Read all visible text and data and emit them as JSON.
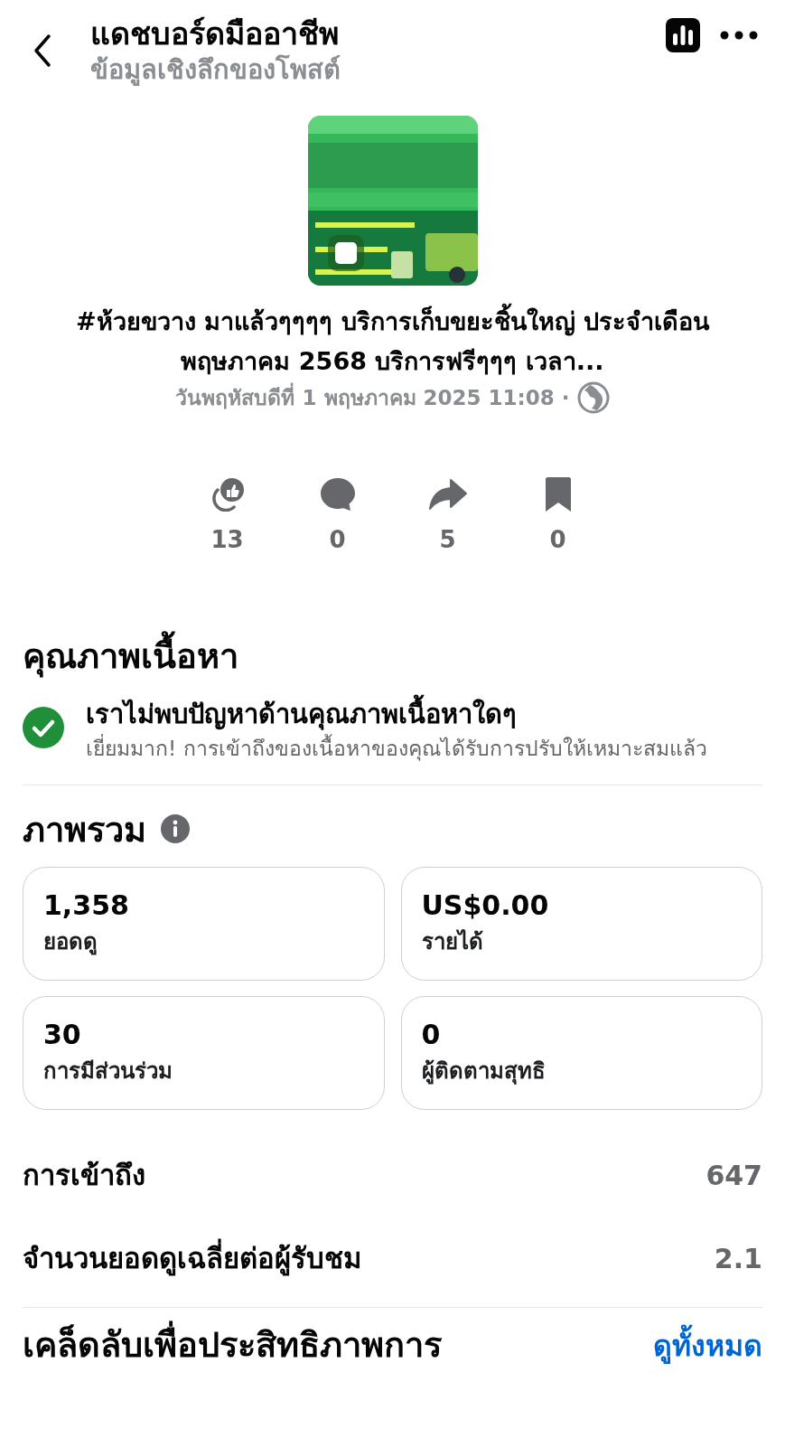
{
  "header": {
    "title": "แดชบอร์ดมืออาชีพ",
    "subtitle": "ข้อมูลเชิงลึกของโพสต์"
  },
  "post": {
    "text": "#ห้วยขวาง มาแล้วๆๆๆๆ บริการเก็บขยะชิ้นใหญ่ ประจำเดือน พฤษภาคม 2568 บริการฟรีๆๆๆ เวลา...",
    "date": "วันพฤหัสบดีที่ 1 พฤษภาคม  2025 11:08 ·"
  },
  "stats": [
    {
      "kind": "reactions",
      "count": "13"
    },
    {
      "kind": "comments",
      "count": "0"
    },
    {
      "kind": "shares",
      "count": "5"
    },
    {
      "kind": "saves",
      "count": "0"
    }
  ],
  "content_quality": {
    "heading": "คุณภาพเนื้อหา",
    "title": "เราไม่พบปัญหาด้านคุณภาพเนื้อหาใดๆ",
    "description": "เยี่ยมมาก! การเข้าถึงของเนื้อหาของคุณได้รับการปรับให้เหมาะสมแล้ว"
  },
  "overview": {
    "heading": "ภาพรวม",
    "cards": [
      {
        "value": "1,358",
        "label": "ยอดดู"
      },
      {
        "value": "US$0.00",
        "label": "รายได้"
      },
      {
        "value": "30",
        "label": "การมีส่วนร่วม"
      },
      {
        "value": "0",
        "label": "ผู้ติดตามสุทธิ"
      }
    ]
  },
  "metrics": [
    {
      "label": "การเข้าถึง",
      "value": "647"
    },
    {
      "label": "จำนวนยอดดูเฉลี่ยต่อผู้รับชม",
      "value": "2.1"
    }
  ],
  "tips": {
    "heading": "เคล็ดลับเพื่อประสิทธิภาพการ",
    "link": "ดูทั้งหมด"
  }
}
